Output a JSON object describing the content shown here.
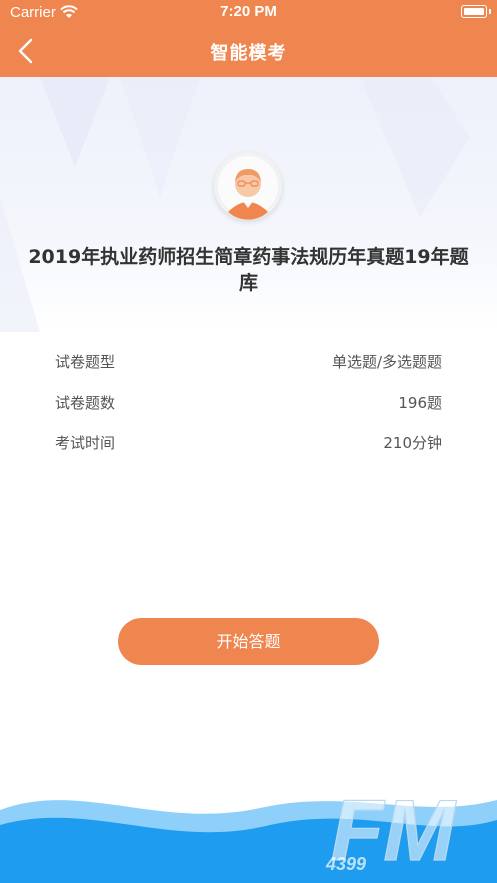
{
  "status_bar": {
    "carrier": "Carrier",
    "time": "7:20 PM"
  },
  "header": {
    "title": "智能模考"
  },
  "exam": {
    "title": "2019年执业药师招生简章药事法规历年真题19年题库",
    "info": [
      {
        "label": "试卷题型",
        "value": "单选题/多选题题"
      },
      {
        "label": "试卷题数",
        "value": "196题"
      },
      {
        "label": "考试时间",
        "value": "210分钟"
      }
    ]
  },
  "actions": {
    "start_label": "开始答题"
  },
  "watermark": {
    "text": "FM",
    "subtext": "4399"
  },
  "colors": {
    "accent": "#f0864f",
    "wave_dark": "#1e9cf0",
    "wave_light": "#8fd0fb"
  }
}
